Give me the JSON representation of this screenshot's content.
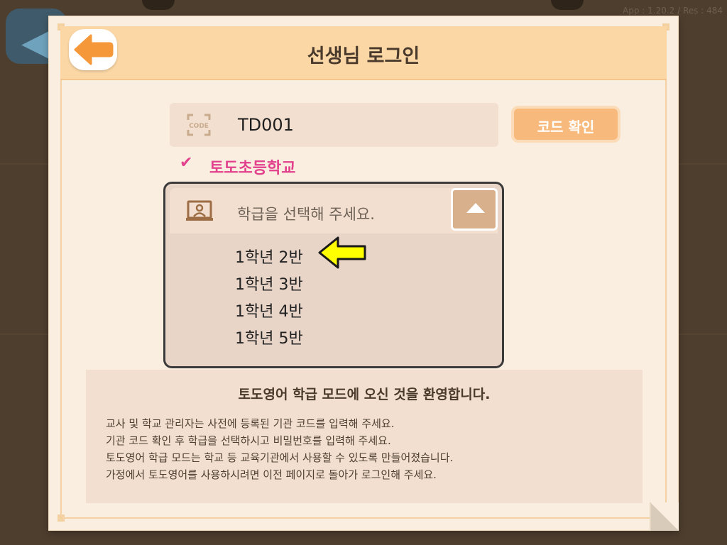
{
  "app_version": "App : 1.20.2 / Res : 484",
  "header": {
    "title": "선생님 로그인"
  },
  "code_section": {
    "icon_label": "CODE",
    "code_value": "TD001",
    "confirm_button": "코드 확인",
    "school_name": "토도초등학교"
  },
  "class_select": {
    "placeholder": "학급을 선택해 주세요.",
    "options": [
      "1학년 2반",
      "1학년 3반",
      "1학년 4반",
      "1학년 5반"
    ]
  },
  "info": {
    "title": "토도영어 학급 모드에 오신 것을 환영합니다.",
    "lines": [
      "교사 및 학교 관리자는 사전에 등록된 기관 코드를 입력해 주세요.",
      "기관 코드 확인 후 학급을 선택하시고 비밀번호를 입력해 주세요.",
      "토도영어 학급 모드는 학교 등 교육기관에서 사용할 수 있도록 만들어졌습니다.",
      "가정에서 토도영어를 사용하시려면 이전 페이지로 돌아가 로그인해 주세요."
    ]
  },
  "colors": {
    "accent_orange": "#f8ba7c",
    "back_arrow_orange": "#f5983a",
    "school_pink": "#e2408d",
    "pointer_yellow": "#ffff00",
    "header_bg": "#fbd7a6"
  },
  "icons": {
    "back": "left-arrow-icon",
    "code": "code-frame-icon",
    "check": "checkmark-icon",
    "class": "classroom-board-icon",
    "toggle": "triangle-up-icon",
    "pointer": "yellow-left-arrow-icon"
  }
}
